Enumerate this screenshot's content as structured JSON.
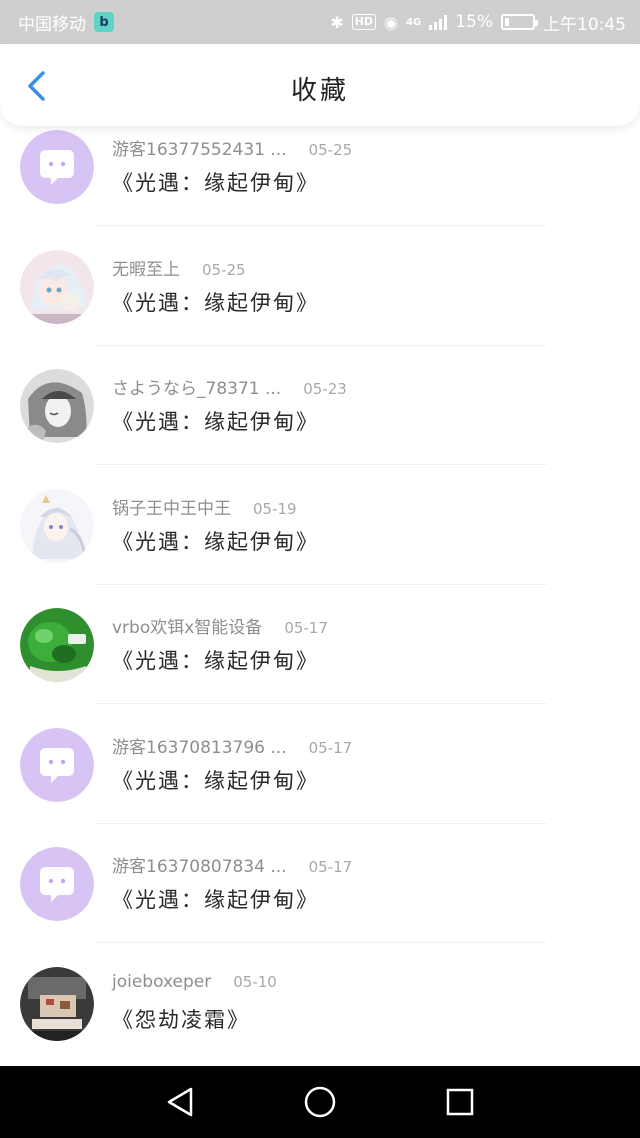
{
  "status_bar": {
    "carrier": "中国移动",
    "app_icon_letter": "b",
    "hd_label": "HD",
    "network_label": "4G",
    "battery_percent": "15%",
    "time": "上午10:45",
    "battery_level": 0.15
  },
  "header": {
    "title": "收藏",
    "back_icon": "chevron-left-icon",
    "accent_color": "#3a8ee6"
  },
  "list": {
    "items": [
      {
        "username": "游客16377552431 ...",
        "date": "05-25",
        "title": "《光遇：缘起伊甸》",
        "avatar": "chat-bubble-icon"
      },
      {
        "username": "无暇至上",
        "date": "05-25",
        "title": "《光遇：缘起伊甸》",
        "avatar": "anime-avatar-white-hair"
      },
      {
        "username": "さようなら_78371 ...",
        "date": "05-23",
        "title": "《光遇：缘起伊甸》",
        "avatar": "anime-avatar-sketch"
      },
      {
        "username": "锅子王中王中王",
        "date": "05-19",
        "title": "《光遇：缘起伊甸》",
        "avatar": "anime-avatar-light"
      },
      {
        "username": "vrbo欢铒x智能设备",
        "date": "05-17",
        "title": "《光遇：缘起伊甸》",
        "avatar": "green-photo-avatar"
      },
      {
        "username": "游客16370813796 ...",
        "date": "05-17",
        "title": "《光遇：缘起伊甸》",
        "avatar": "chat-bubble-icon"
      },
      {
        "username": "游客16370807834 ...",
        "date": "05-17",
        "title": "《光遇：缘起伊甸》",
        "avatar": "chat-bubble-icon"
      },
      {
        "username": "joieboxeper",
        "date": "05-10",
        "title": "《怨劫凌霜》",
        "avatar": "photo-avatar-dark"
      }
    ]
  },
  "nav_bar": {
    "back_icon": "triangle-back-icon",
    "home_icon": "circle-home-icon",
    "recents_icon": "square-recents-icon"
  }
}
